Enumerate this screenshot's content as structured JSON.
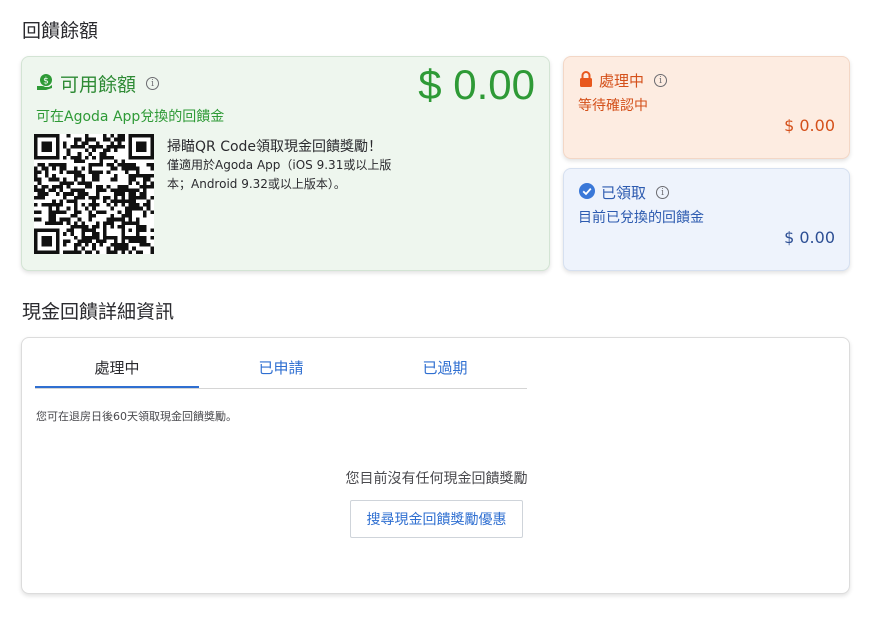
{
  "headings": {
    "balance": "回饋餘額",
    "details": "現金回饋詳細資訊"
  },
  "available": {
    "label": "可用餘額",
    "amount": "$ 0.00",
    "subtitle": "可在Agoda App兌換的回饋金",
    "scan_title": "掃瞄QR Code領取現金回饋獎勵！",
    "scan_desc": "僅適用於Agoda App（iOS 9.31或以上版本；Android 9.32或以上版本）。",
    "accent_color": "#2e9a36"
  },
  "pending": {
    "label": "處理中",
    "subtitle": "等待確認中",
    "amount": "$ 0.00",
    "accent_color": "#d4501a"
  },
  "claimed": {
    "label": "已領取",
    "subtitle": "目前已兌換的回饋金",
    "amount": "$ 0.00",
    "accent_color": "#2d5bb0"
  },
  "details": {
    "tabs": [
      {
        "label": "處理中",
        "active": true
      },
      {
        "label": "已申請",
        "active": false
      },
      {
        "label": "已過期",
        "active": false
      }
    ],
    "hint": "您可在退房日後60天領取現金回饋獎勵。",
    "empty_message": "您目前沒有任何現金回饋獎勵",
    "search_button": "搜尋現金回饋獎勵優惠"
  }
}
